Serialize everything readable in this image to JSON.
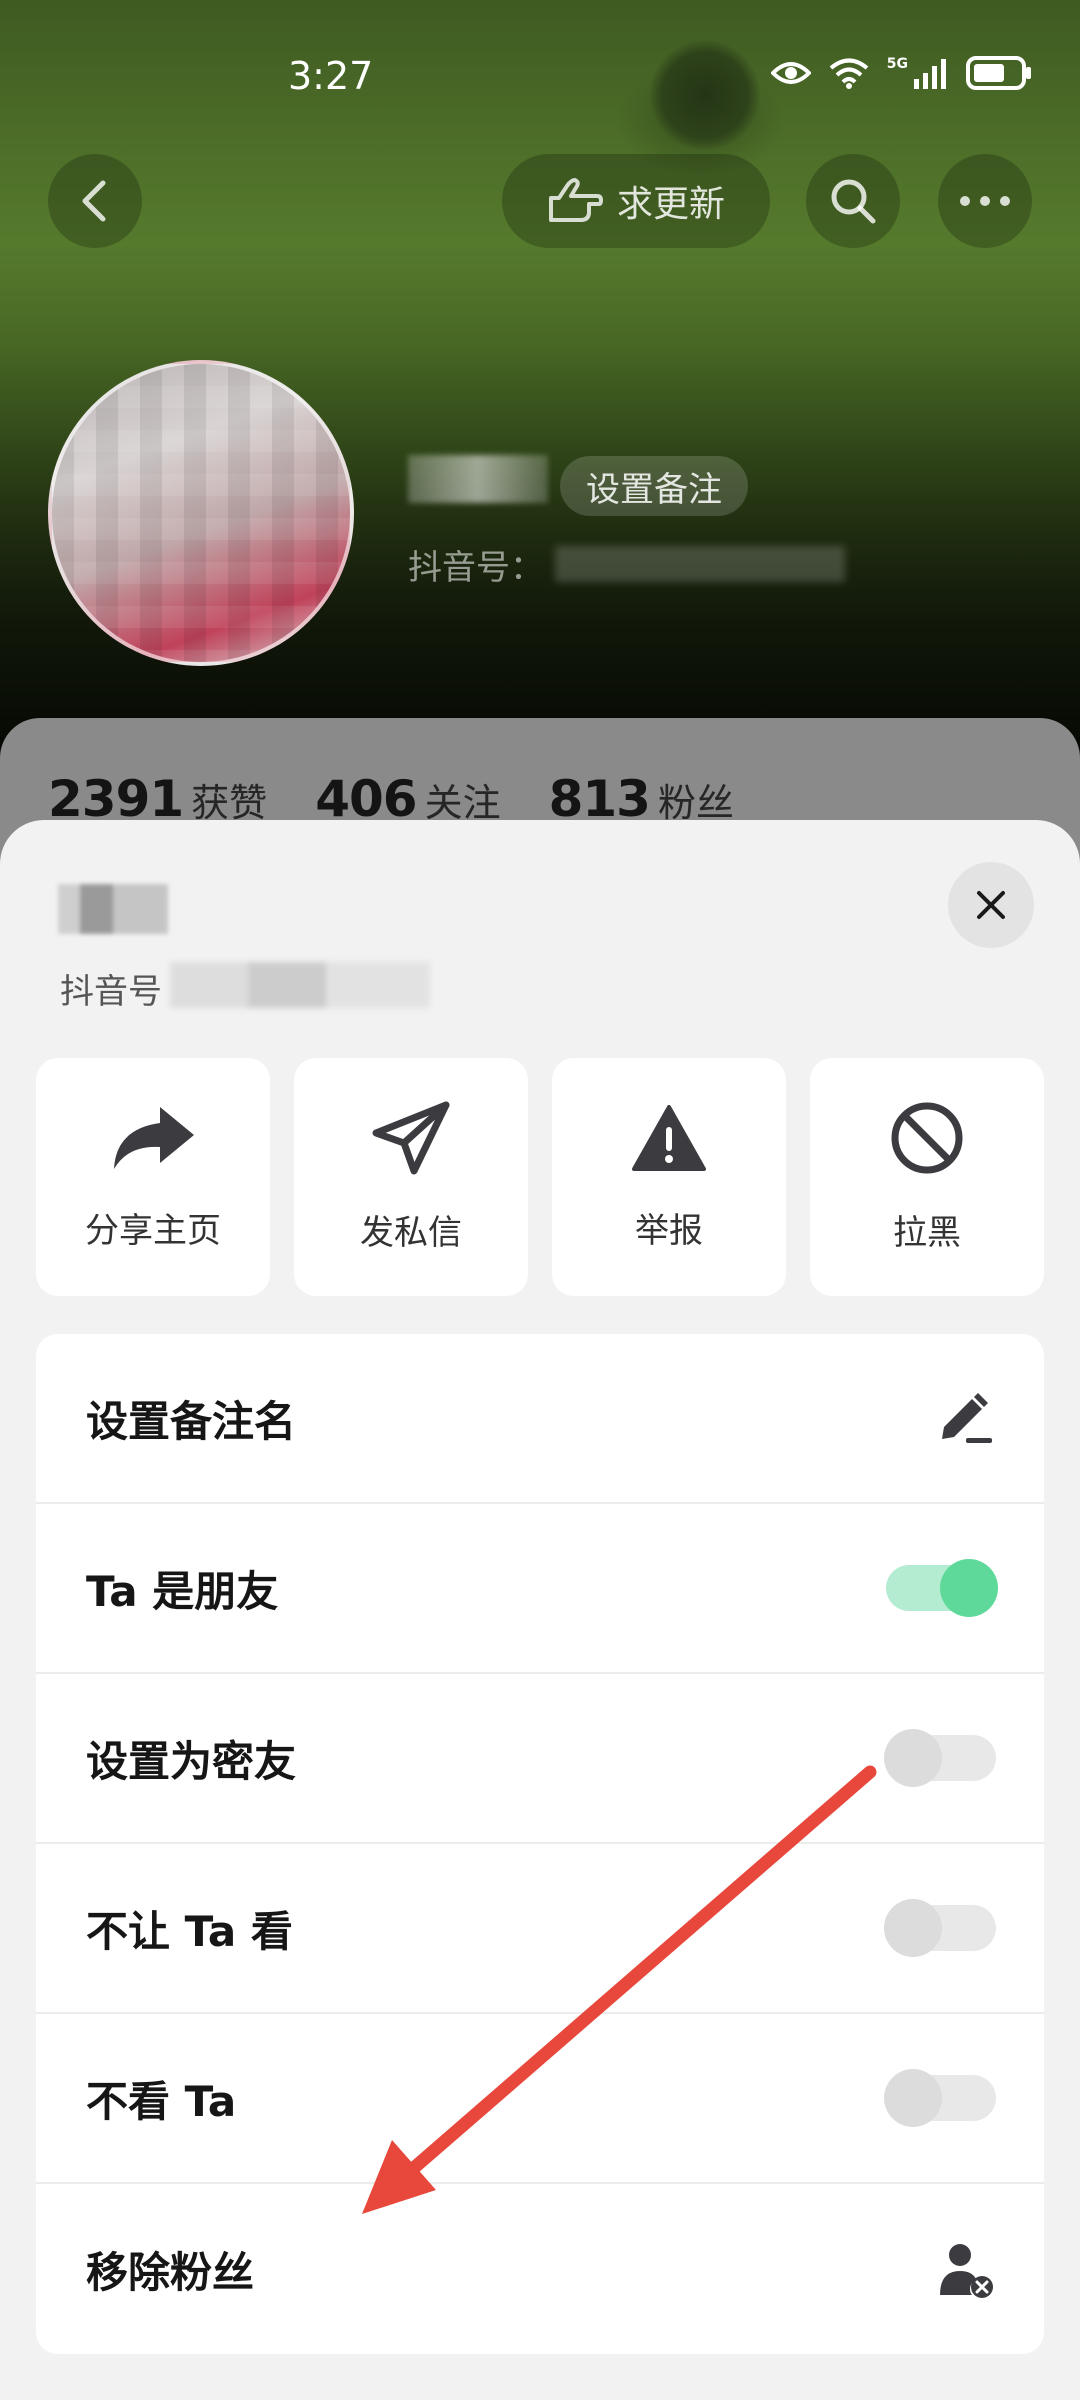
{
  "status_bar": {
    "time": "3:27",
    "network": "5G"
  },
  "header": {
    "update_request_label": "求更新"
  },
  "profile": {
    "remark_tag": "设置备注",
    "id_label": "抖音号：",
    "stats": [
      {
        "value": "2391",
        "label": "获赞"
      },
      {
        "value": "406",
        "label": "关注"
      },
      {
        "value": "813",
        "label": "粉丝"
      }
    ]
  },
  "sheet": {
    "id_label": "抖音号",
    "actions": [
      {
        "label": "分享主页",
        "icon": "share-icon"
      },
      {
        "label": "发私信",
        "icon": "send-icon"
      },
      {
        "label": "举报",
        "icon": "warning-icon"
      },
      {
        "label": "拉黑",
        "icon": "block-icon"
      }
    ],
    "settings": [
      {
        "label": "设置备注名",
        "control": "pencil-icon"
      },
      {
        "label": "Ta 是朋友",
        "control": "toggle",
        "on": true
      },
      {
        "label": "设置为密友",
        "control": "toggle",
        "on": false
      },
      {
        "label": "不让 Ta 看",
        "control": "toggle",
        "on": false
      },
      {
        "label": "不看 Ta",
        "control": "toggle",
        "on": false
      },
      {
        "label": "移除粉丝",
        "control": "remove-user-icon"
      }
    ]
  },
  "colors": {
    "toggle_on": "#5fd99a",
    "annotation_arrow": "#e8473b"
  }
}
